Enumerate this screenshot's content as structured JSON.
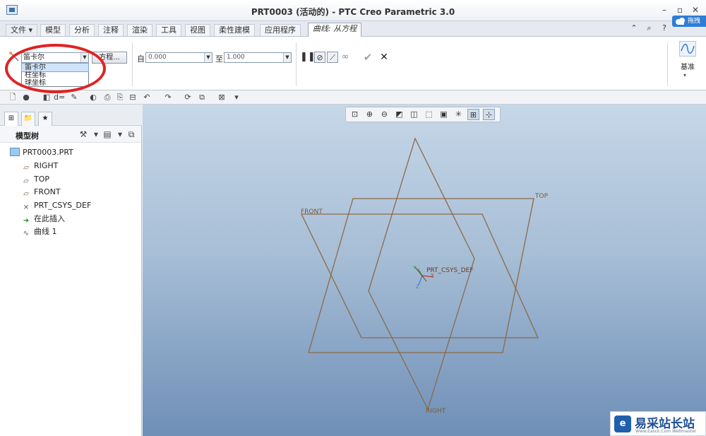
{
  "window": {
    "title": "PRT0003 (活动的) - PTC Creo Parametric 3.0"
  },
  "menu_tabs": [
    "文件",
    "模型",
    "分析",
    "注释",
    "渲染",
    "工具",
    "视图",
    "柔性建模",
    "应用程序"
  ],
  "active_tab": "曲线: 从方程",
  "cloud_badge": "拖拽",
  "ribbon": {
    "coord_type_value": "笛卡尔",
    "coord_options": [
      "笛卡尔",
      "柱坐标",
      "球坐标"
    ],
    "equation_button": "方程...",
    "from_label": "自",
    "from_value": "0.000",
    "to_label": "至",
    "to_value": "1.000",
    "datum_label": "基准"
  },
  "left_panel": {
    "header": "模型树",
    "tree": [
      {
        "label": "PRT0003.PRT",
        "icon": "part-icon"
      },
      {
        "label": "RIGHT",
        "icon": "datum-plane-icon"
      },
      {
        "label": "TOP",
        "icon": "datum-plane-icon"
      },
      {
        "label": "FRONT",
        "icon": "datum-plane-icon"
      },
      {
        "label": "PRT_CSYS_DEF",
        "icon": "csys-icon"
      },
      {
        "label": "在此插入",
        "icon": "insert-arrow-icon"
      },
      {
        "label": "曲线 1",
        "icon": "curve-icon"
      }
    ]
  },
  "graphics": {
    "plane_labels": {
      "top": "TOP",
      "front": "FRONT",
      "right": "RIGHT"
    },
    "csys_label": "PRT_CSYS_DEF",
    "axis_x": "X",
    "axis_y": "Y",
    "axis_z": "Z"
  },
  "watermark": {
    "text": "易采站长站",
    "sub": "Www.Easck.Com Webmaster"
  },
  "colors": {
    "annotation": "#e02222",
    "plane": "#8a6a4a",
    "accent": "#2f7dd6"
  }
}
